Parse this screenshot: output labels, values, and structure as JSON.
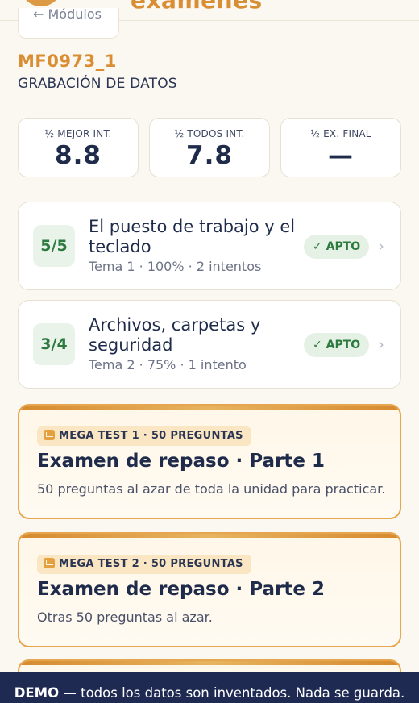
{
  "header": {
    "brand_text": "exámenes",
    "back_label": "← Módulos"
  },
  "module": {
    "code": "MF0973_1",
    "name": "GRABACIÓN DE DATOS"
  },
  "stats": [
    {
      "label": "½ MEJOR INT.",
      "value": "8.8"
    },
    {
      "label": "½ TODOS INT.",
      "value": "7.8"
    },
    {
      "label": "½ EX. FINAL",
      "value": "—"
    }
  ],
  "topics": [
    {
      "score": "5/5",
      "title": "El puesto de trabajo y el teclado",
      "meta": "Tema 1 · 100% · 2 intentos",
      "badge": "✓ APTO",
      "chevron": "›"
    },
    {
      "score": "3/4",
      "title": "Archivos, carpetas y seguridad",
      "meta": "Tema 2 · 75% · 1 intento",
      "badge": "✓ APTO",
      "chevron": "›"
    }
  ],
  "mega_tests": [
    {
      "tag": "MEGA TEST 1 · 50 PREGUNTAS",
      "icon": "repeat-icon",
      "title": "Examen de repaso · Parte 1",
      "desc": "50 preguntas al azar de toda la unidad para practicar."
    },
    {
      "tag": "MEGA TEST 2 · 50 PREGUNTAS",
      "icon": "repeat-icon",
      "title": "Examen de repaso · Parte 2",
      "desc": "Otras 50 preguntas al azar."
    }
  ],
  "demo_banner": {
    "strong": "DEMO",
    "text": " — todos los datos son inventados. Nada se guarda."
  },
  "colors": {
    "accent": "#d98e34",
    "navy": "#1e2a52",
    "success": "#2d7a3f",
    "background": "#fbf7f1"
  }
}
